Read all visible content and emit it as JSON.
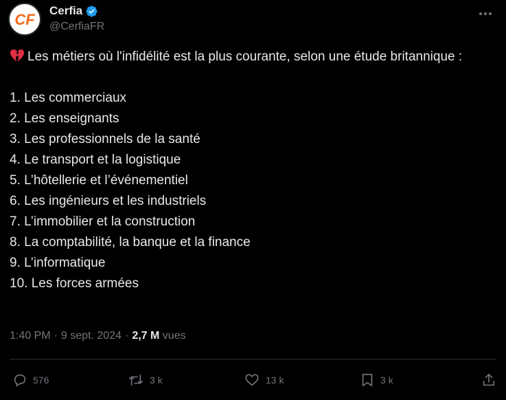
{
  "author": {
    "display_name": "Cerfia",
    "handle": "@CerfiaFR",
    "avatar_initials": "CF"
  },
  "tweet": {
    "intro": "Les métiers où l'infidélité est la plus courante, selon une étude britannique :",
    "items": [
      "1. Les commerciaux",
      "2. Les enseignants",
      "3. Les professionnels de la santé",
      "4. Le transport et la logistique",
      "5. L’hôtellerie et l’événementiel",
      "6. Les ingénieurs et les industriels",
      "7. L’immobilier et la construction",
      "8. La comptabilité, la banque et la finance",
      "9. L’informatique",
      "10. Les forces armées"
    ]
  },
  "meta": {
    "time": "1:40 PM",
    "sep1": "·",
    "date": "9 sept. 2024",
    "sep2": "·",
    "views_count": "2,7 M",
    "views_label": "vues"
  },
  "actions": {
    "replies": "576",
    "reposts": "3 k",
    "likes": "13 k",
    "bookmarks": "3 k"
  },
  "icons": {
    "emoji": "broken-heart",
    "verified": "verified-badge",
    "more": "more-dots",
    "reply": "reply-bubble",
    "repost": "repost-arrows",
    "like": "heart",
    "bookmark": "bookmark",
    "share": "share-upload"
  },
  "colors": {
    "background": "#000000",
    "text": "#e7e9ea",
    "muted": "#71767b",
    "verified": "#1d9bf0",
    "brand_orange": "#f26a1b"
  }
}
